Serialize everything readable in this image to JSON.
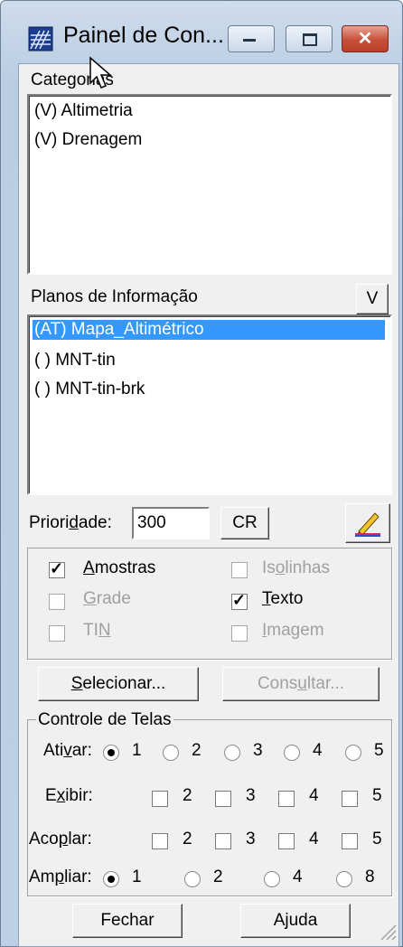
{
  "window": {
    "title": "Painel de Con..."
  },
  "categorias": {
    "label": "Categorias",
    "items": [
      "(V) Altimetria",
      "(V) Drenagem"
    ]
  },
  "planos": {
    "label": "Planos de Informação",
    "v_button": "V",
    "items": [
      "(AT) Mapa_Altimétrico",
      "( ) MNT-tin",
      "( ) MNT-tin-brk"
    ],
    "selected_index": 0
  },
  "prioridade": {
    "label": "Prioridade:",
    "value": "300",
    "cr_button": "CR"
  },
  "representacoes": {
    "amostras": {
      "label": "Amostras",
      "checked": true,
      "enabled": true
    },
    "isolinhas": {
      "label": "Isolinhas",
      "checked": false,
      "enabled": false
    },
    "grade": {
      "label": "Grade",
      "checked": false,
      "enabled": false
    },
    "texto": {
      "label": "Texto",
      "checked": true,
      "enabled": true
    },
    "tin": {
      "label": "TIN",
      "checked": false,
      "enabled": false
    },
    "imagem": {
      "label": "Imagem",
      "checked": false,
      "enabled": false
    }
  },
  "buttons": {
    "selecionar": "Selecionar...",
    "consultar": "Consultar...",
    "fechar": "Fechar",
    "ajuda": "Ajuda"
  },
  "controle": {
    "title": "Controle de Telas",
    "ativar": {
      "label": "Ativar:",
      "options": [
        "1",
        "2",
        "3",
        "4",
        "5"
      ],
      "selected": "1"
    },
    "exibir": {
      "label": "Exibir:",
      "options": [
        "2",
        "3",
        "4",
        "5"
      ]
    },
    "acoplar": {
      "label": "Acoplar:",
      "options": [
        "2",
        "3",
        "4",
        "5"
      ]
    },
    "ampliar": {
      "label": "Ampliar:",
      "options": [
        "1",
        "2",
        "4",
        "8"
      ],
      "selected": "1"
    }
  },
  "colors": {
    "selection": "#3399ff",
    "face": "#f0f0f0",
    "close_button": "#c7503a"
  }
}
